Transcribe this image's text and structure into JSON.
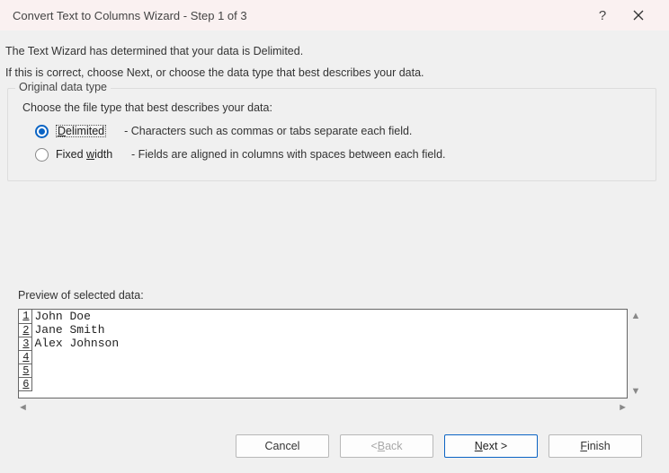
{
  "titlebar": {
    "title": "Convert Text to Columns Wizard - Step 1 of 3",
    "help": "?"
  },
  "intro": {
    "line1": "The Text Wizard has determined that your data is Delimited.",
    "line2": "If this is correct, choose Next, or choose the data type that best describes your data."
  },
  "fieldset": {
    "legend": "Original data type",
    "choose": "Choose the file type that best describes your data:",
    "delimited": {
      "prefix": "D",
      "rest": "elimited",
      "desc": "-  Characters such as commas or tabs separate each field."
    },
    "fixed": {
      "prefix": "Fixed ",
      "ul": "w",
      "rest": "idth",
      "desc": "-  Fields are aligned in columns with spaces between each field."
    }
  },
  "preview": {
    "label": "Preview of selected data:",
    "rows": [
      {
        "n": "1",
        "v": "John Doe"
      },
      {
        "n": "2",
        "v": "Jane Smith"
      },
      {
        "n": "3",
        "v": "Alex Johnson"
      },
      {
        "n": "4",
        "v": ""
      },
      {
        "n": "5",
        "v": ""
      },
      {
        "n": "6",
        "v": ""
      }
    ]
  },
  "buttons": {
    "cancel": "Cancel",
    "back_prefix": "< ",
    "back_ul": "B",
    "back_rest": "ack",
    "next_ul": "N",
    "next_rest": "ext >",
    "finish_ul": "F",
    "finish_rest": "inish"
  }
}
